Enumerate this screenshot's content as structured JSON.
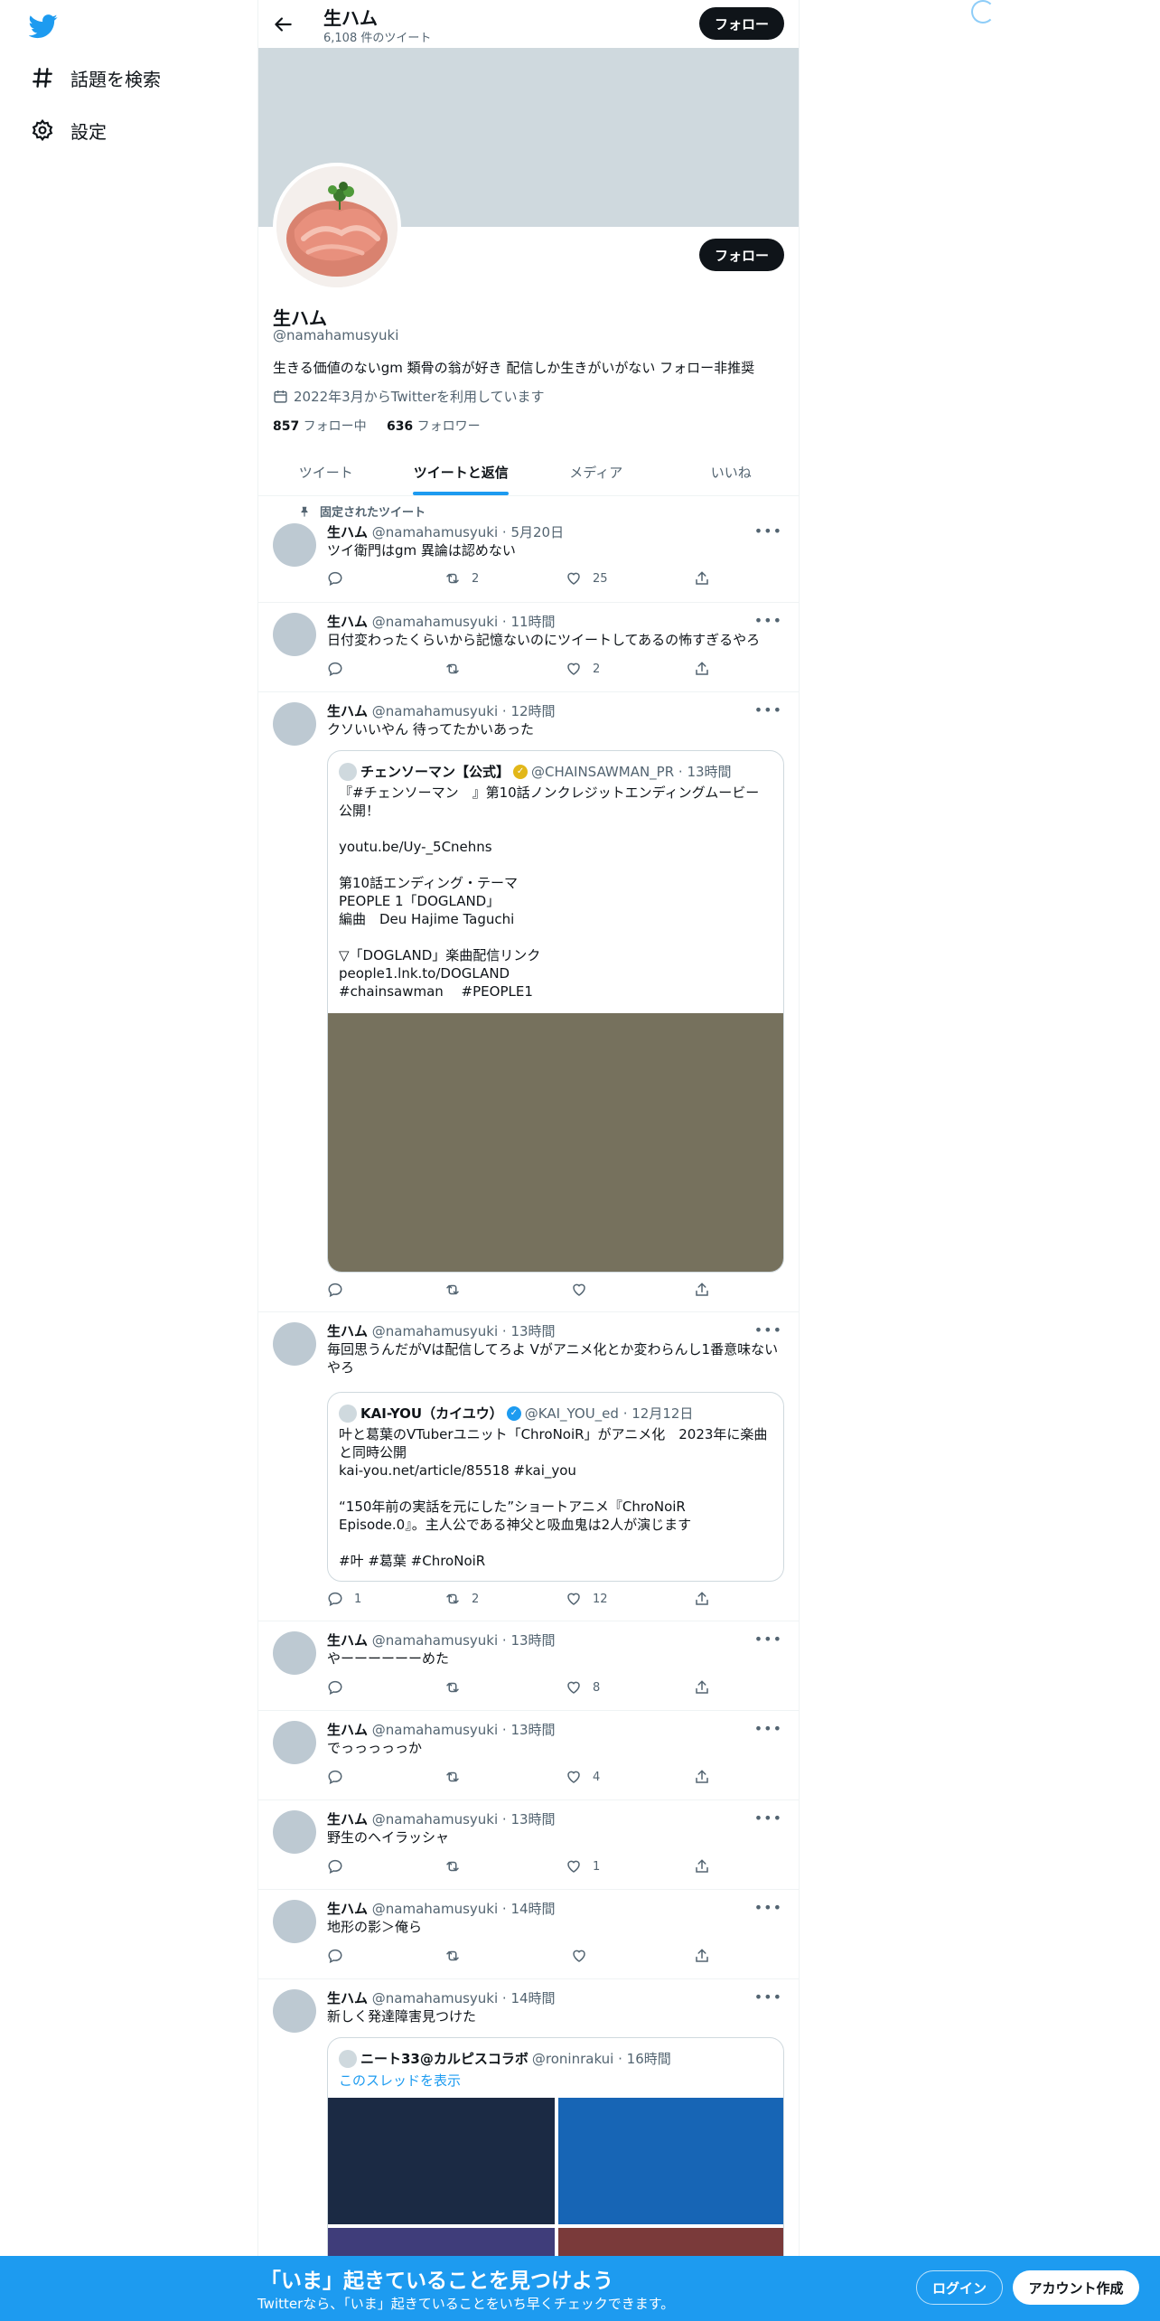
{
  "nav": {
    "explore_label": "話題を検索",
    "settings_label": "設定"
  },
  "header": {
    "title": "生ハム",
    "tweet_count": "6,108 件のツイート",
    "follow_label": "フォロー"
  },
  "profile": {
    "name": "生ハム",
    "handle": "@namahamusyuki",
    "bio": "生きる価値のないgm 類骨の翁が好き 配信しか生きがいがない フォロー非推奨",
    "joined": "2022年3月からTwitterを利用しています",
    "following_count": "857",
    "following_label": " フォロー中",
    "followers_count": "636",
    "followers_label": " フォロワー",
    "follow_label": "フォロー"
  },
  "tabs": [
    "ツイート",
    "ツイートと返信",
    "メディア",
    "いいね"
  ],
  "pinned_label": "固定されたツイート",
  "tweets": [
    {
      "name": "生ハム",
      "meta": " @namahamusyuki · 5月20日",
      "text": "ツイ衛門はgm 異論は認めない",
      "reply": "",
      "retweet": "2",
      "like": "25"
    },
    {
      "name": "生ハム",
      "meta": " @namahamusyuki · 11時間",
      "text": "日付変わったくらいから記憶ないのにツイートしてあるの怖すぎるやろ",
      "reply": "",
      "retweet": "",
      "like": "2"
    },
    {
      "name": "生ハム",
      "meta": " @namahamusyuki · 12時間",
      "text": "クソいいやん 待ってたかいあった",
      "reply": "",
      "retweet": "",
      "like": "",
      "quote": {
        "name": "チェンソーマン【公式】",
        "meta": "@CHAINSAWMAN_PR · 13時間",
        "body": "『#チェンソーマン　』第10話ノンクレジットエンディングムービー公開！\n\nyoutu.be/Uy-_5Cnehns\n\n第10話エンディング・テーマ\nPEOPLE 1「DOGLAND」\n編曲　Deu Hajime Taguchi\n\n▽「DOGLAND」楽曲配信リンク\npeople1.lnk.to/DOGLAND\n#chainsawman　 #PEOPLE1"
      }
    },
    {
      "name": "生ハム",
      "meta": " @namahamusyuki · 13時間",
      "text": "毎回思うんだがVは配信してろよ Vがアニメ化とか変わらんし1番意味ないやろ",
      "reply": "1",
      "retweet": "2",
      "like": "12",
      "quote": {
        "name": "KAI-YOU（カイユウ）",
        "meta": "@KAI_YOU_ed · 12月12日",
        "body": "叶と葛葉のVTuberユニット「ChroNoiR」がアニメ化　2023年に楽曲と同時公開\nkai-you.net/article/85518 #kai_you\n\n“150年前の実話を元にした”ショートアニメ『ChroNoiR Episode.0』。主人公である神父と吸血鬼は2人が演じます\n\n#叶 #葛葉 #ChroNoiR"
      }
    },
    {
      "name": "生ハム",
      "meta": " @namahamusyuki · 13時間",
      "text": "やーーーーーーめた",
      "reply": "",
      "retweet": "",
      "like": "8"
    },
    {
      "name": "生ハム",
      "meta": " @namahamusyuki · 13時間",
      "text": "でっっっっっか",
      "reply": "",
      "retweet": "",
      "like": "4"
    },
    {
      "name": "生ハム",
      "meta": " @namahamusyuki · 13時間",
      "text": "野生のヘイラッシャ",
      "reply": "",
      "retweet": "",
      "like": "1"
    },
    {
      "name": "生ハム",
      "meta": " @namahamusyuki · 14時間",
      "text": "地形の影＞俺ら",
      "reply": "",
      "retweet": "",
      "like": ""
    },
    {
      "name": "生ハム",
      "meta": " @namahamusyuki · 14時間",
      "text": "新しく発達障害見つけた",
      "reply": "",
      "retweet": "",
      "like": "",
      "quote": {
        "name": "ニート33@カルピスコラボ",
        "meta": "@roninrakui · 16時間",
        "thread_link": "このスレッドを表示"
      }
    }
  ],
  "bottom": {
    "title": "「いま」起きていることを見つけよう",
    "subtitle": "Twitterなら、「いま」起きていることをいち早くチェックできます。",
    "login_label": "ログイン",
    "signup_label": "アカウント作成"
  },
  "colors": {
    "accent": "#1d9bf0",
    "text": "#0f1419",
    "muted": "#536471",
    "banner": "#cfd9de",
    "verified_gold": "#e2b719"
  }
}
